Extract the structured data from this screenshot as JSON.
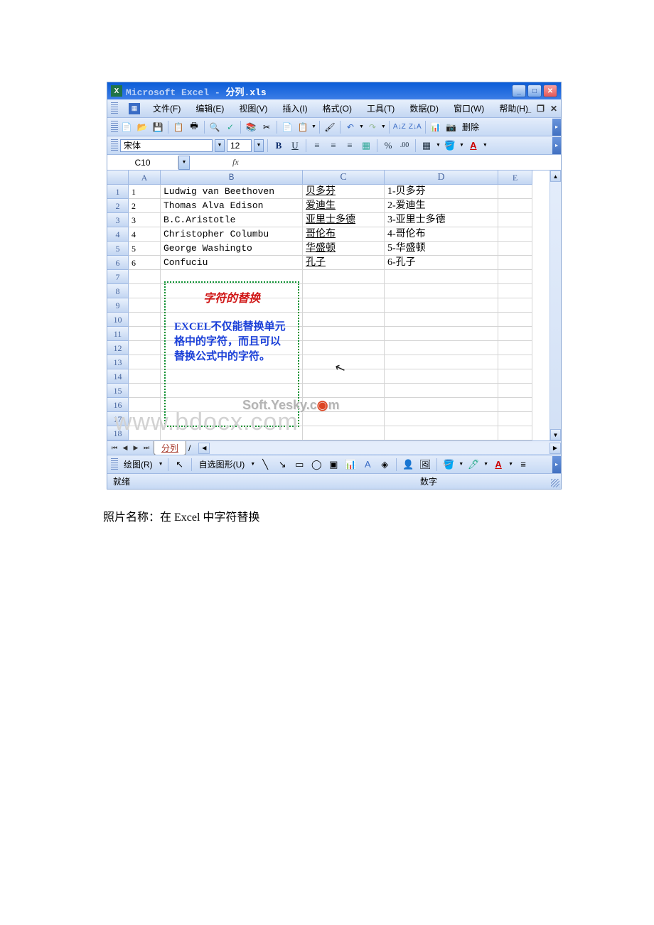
{
  "title": {
    "app": "Microsoft Excel",
    "sep": " - ",
    "file": "分列.xls"
  },
  "menu": {
    "file": "文件(F)",
    "edit": "编辑(E)",
    "view": "视图(V)",
    "insert": "插入(I)",
    "format": "格式(O)",
    "tools": "工具(T)",
    "data": "数据(D)",
    "window": "窗口(W)",
    "help": "帮助(H)"
  },
  "toolbar": {
    "delete": "删除"
  },
  "format": {
    "font_name": "宋体",
    "font_size": "12"
  },
  "formula_bar": {
    "cell_ref": "C10",
    "fx": "fx"
  },
  "columns": {
    "A": "A",
    "B": "B",
    "C": "C",
    "D": "D",
    "E": "E"
  },
  "rows": [
    {
      "n": "1",
      "a": "1",
      "b": "Ludwig van Beethoven",
      "c": "贝多芬",
      "d": "1-贝多芬"
    },
    {
      "n": "2",
      "a": "2",
      "b": "Thomas Alva Edison",
      "c": "爱迪生",
      "d": "2-爱迪生"
    },
    {
      "n": "3",
      "a": "3",
      "b": "B.C.Aristotle",
      "c": "亚里士多德",
      "d": "3-亚里士多德"
    },
    {
      "n": "4",
      "a": "4",
      "b": "Christopher Columbu",
      "c": "哥伦布",
      "d": "4-哥伦布"
    },
    {
      "n": "5",
      "a": "5",
      "b": "George Washingto",
      "c": "华盛顿",
      "d": "5-华盛顿"
    },
    {
      "n": "6",
      "a": "6",
      "b": "Confuciu",
      "c": "孔子",
      "d": "6-孔子"
    }
  ],
  "empty_rows": [
    "7",
    "8",
    "9",
    "10",
    "11",
    "12",
    "13",
    "14",
    "15",
    "16",
    "17",
    "18"
  ],
  "annotation": {
    "title": "字符的替换",
    "body": "EXCEL不仅能替换单元格中的字符，而且可以替换公式中的字符。"
  },
  "watermarks": {
    "soft_l": "Soft.Yesky.c",
    "soft_r": "m",
    "bdocx": "www.bdocx.com"
  },
  "sheet": {
    "name": "分列"
  },
  "drawing": {
    "label": "绘图(R)",
    "autoshape": "自选图形(U)"
  },
  "status": {
    "left": "就绪",
    "right": "数字"
  },
  "caption": "照片名称：在 Excel 中字符替换"
}
